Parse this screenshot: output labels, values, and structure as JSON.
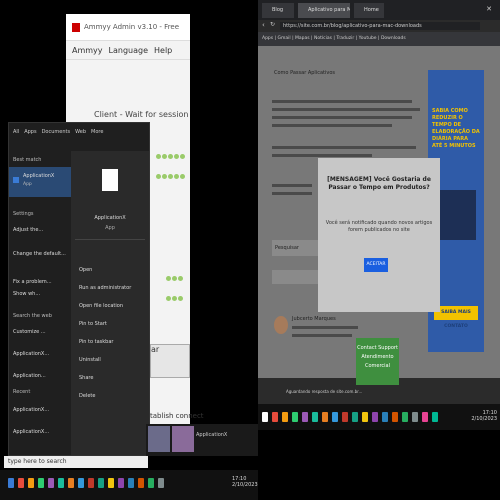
{
  "left_monitor": {
    "ammyy": {
      "title": "Ammyy Admin v3.10 - Free",
      "menu": [
        "Ammyy",
        "Language",
        "Help"
      ],
      "client_label": "Client - Wait for session",
      "button_label": "ar",
      "status_text": "establish connect"
    },
    "start_menu": {
      "tabs": [
        "All",
        "Apps",
        "Documents",
        "Web",
        "More"
      ],
      "best_match_header": "Best match",
      "best_match_title": "ApplicationX",
      "best_match_subtitle": "App",
      "settings_header": "Settings",
      "settings_items": [
        "Adjust the...",
        "Change the default...",
        "Fix a problem...",
        "Show wh..."
      ],
      "web_header": "Search the web",
      "web_items": [
        "Customize ...",
        "ApplicationX...",
        "Application...",
        "Applicatio..."
      ],
      "recent_header": "Recent",
      "recent_items": [
        "ApplicationX...",
        "ApplicationX..."
      ],
      "right_app_title": "ApplicationX",
      "right_app_subtitle": "App",
      "actions": [
        "Open",
        "Run as administrator",
        "Open file location",
        "Pin to Start",
        "Pin to taskbar",
        "Uninstall",
        "Share",
        "Delete"
      ]
    },
    "search_query": "type here to search",
    "thumb_caption": "ApplicationX",
    "clock": {
      "time": "17:10",
      "date": "2/10/2023"
    }
  },
  "right_monitor": {
    "tabs": [
      "Blog",
      "Aplicativo para Mac",
      "Home"
    ],
    "url": "https://site.com.br/blog/aplicativo-para-mac-downloads",
    "bookmarks": "Apps | Gmail | Mapas | Notícias | Traduzir | Youtube | Downloads",
    "article_heading": "Como Passar Aplicativos",
    "ad": {
      "text": "SABIA COMO REDUZIR O TEMPO DE ELABORAÇÃO DA DIÁRIA PARA ATÉ 5 MINUTOS",
      "button": "SAIBA MAIS CONTATO"
    },
    "modal": {
      "title": "[MENSAGEM] Você Gostaria de Passar o Tempo em Produtos?",
      "body": "Você será notificado quando novos artigos forem publicados no site",
      "button": "ACEITAR"
    },
    "search_field": "Pesquisar",
    "author": "Jubcerto Marques",
    "green_box": [
      "Contact Support",
      "Atendimento",
      "Comercial"
    ],
    "status_line": "Aguardando resposta de site.com.br...",
    "clock": {
      "time": "17:10",
      "date": "2/10/2023"
    }
  },
  "colors": {
    "accent_blue": "#1a5fe0",
    "ad_blue": "#2f5ba8",
    "ad_yellow": "#f2c200",
    "green": "#3f8f3f",
    "ammyy_dots": "#9acb6a"
  }
}
